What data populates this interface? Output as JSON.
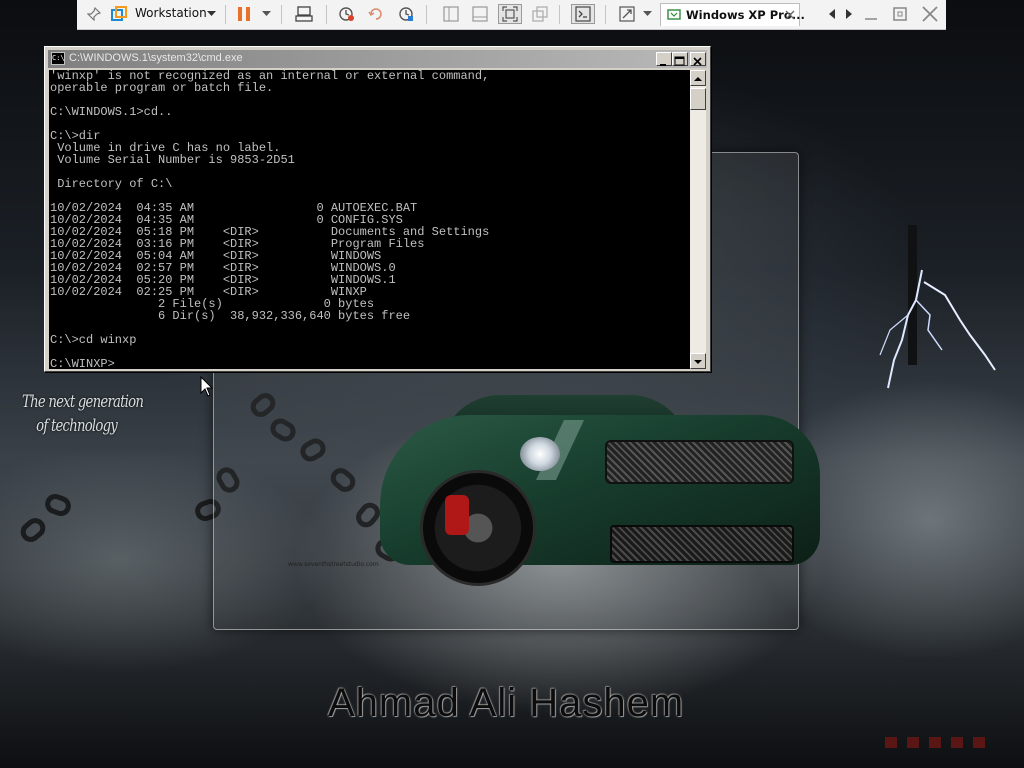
{
  "toolbar": {
    "vm_menu_label": "Workstation",
    "tab_label": "Windows XP Pro...",
    "icons": [
      "pin-icon",
      "vmware-logo-icon",
      "pause-icon",
      "send-keys-icon",
      "snapshot-icon",
      "revert-icon",
      "snapshot-manager-icon",
      "sidebar-icon",
      "thumbnail-icon",
      "fullscreen-icon",
      "unity-icon",
      "terminal-icon",
      "stretch-icon",
      "vm-tab-icon",
      "minimize-icon",
      "maximize-icon",
      "close-icon"
    ],
    "colors": {
      "pause": "#e8712a",
      "snapshot": "#d9412b",
      "tab_border": "#2f8a3b"
    }
  },
  "cmd": {
    "title": "C:\\WINDOWS.1\\system32\\cmd.exe",
    "icon_text": "C:\\",
    "lines": [
      "'winxp' is not recognized as an internal or external command,",
      "operable program or batch file.",
      "",
      "C:\\WINDOWS.1>cd..",
      "",
      "C:\\>dir",
      " Volume in drive C has no label.",
      " Volume Serial Number is 9853-2D51",
      "",
      " Directory of C:\\",
      "",
      "10/02/2024  04:35 AM                 0 AUTOEXEC.BAT",
      "10/02/2024  04:35 AM                 0 CONFIG.SYS",
      "10/02/2024  05:18 PM    <DIR>          Documents and Settings",
      "10/02/2024  03:16 PM    <DIR>          Program Files",
      "10/02/2024  05:04 AM    <DIR>          WINDOWS",
      "10/02/2024  02:57 PM    <DIR>          WINDOWS.0",
      "10/02/2024  05:20 PM    <DIR>          WINDOWS.1",
      "10/02/2024  02:25 PM    <DIR>          WINXP",
      "               2 File(s)              0 bytes",
      "               6 Dir(s)  38,932,336,640 bytes free",
      "",
      "C:\\>cd winxp",
      "",
      "C:\\WINXP>"
    ],
    "colors": {
      "background": "#000000",
      "text": "#c0c0c0"
    }
  },
  "desktop": {
    "tagline_line1": "The next generation",
    "tagline_line2": "of technology",
    "signature": "Ahmad Ali Hashem",
    "watermark_url": "www.seventhstreetstudio.com"
  }
}
